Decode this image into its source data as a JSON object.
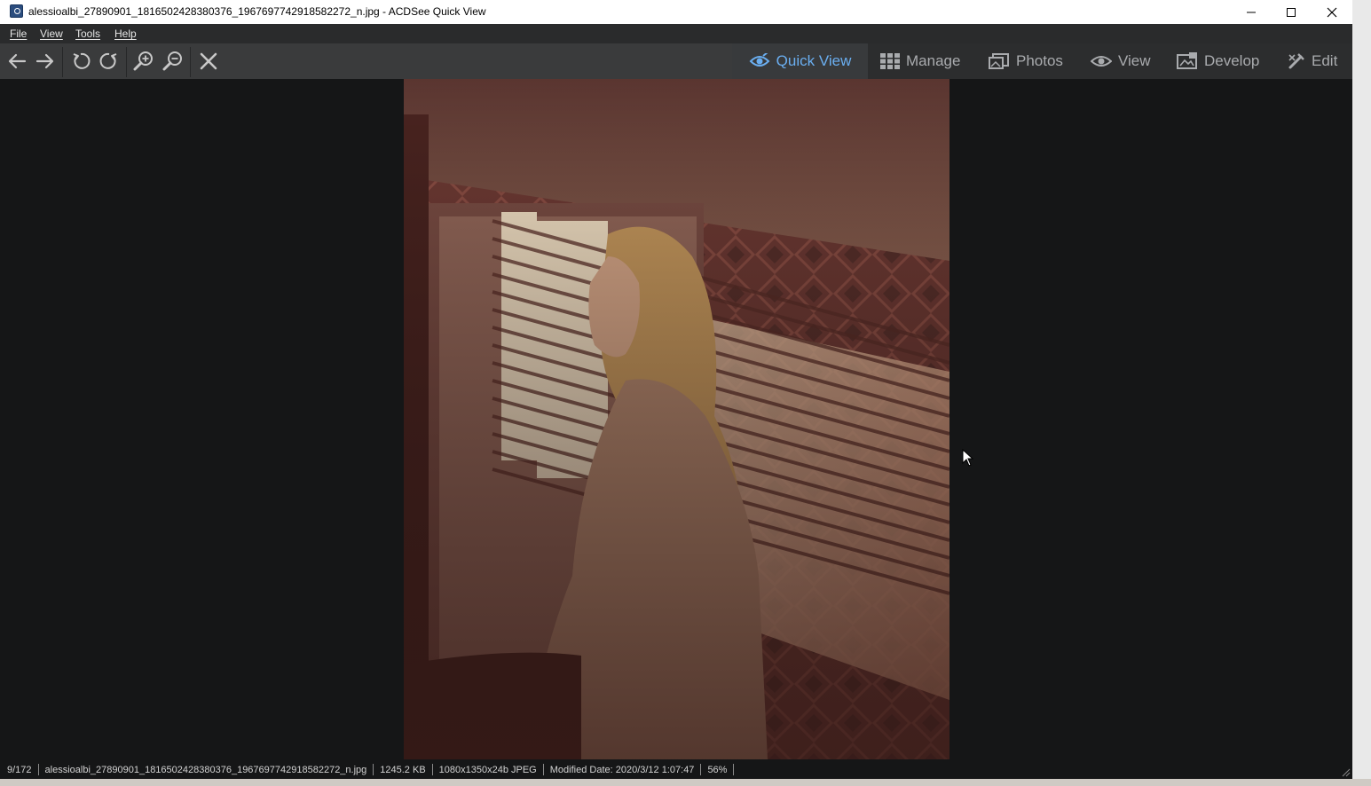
{
  "window": {
    "title": "alessioalbi_27890901_1816502428380376_1967697742918582272_n.jpg - ACDSee Quick View"
  },
  "menu": [
    "File",
    "View",
    "Tools",
    "Help"
  ],
  "toolbar": {
    "nav_icons": [
      "arrow-left-icon",
      "arrow-right-icon",
      "rotate-left-icon",
      "rotate-right-icon",
      "zoom-in-icon",
      "zoom-out-icon",
      "close-x-icon"
    ]
  },
  "modes": [
    {
      "label": "Quick View",
      "icon": "eye-icon",
      "active": true
    },
    {
      "label": "Manage",
      "icon": "grid-icon",
      "active": false
    },
    {
      "label": "Photos",
      "icon": "photos-icon",
      "active": false
    },
    {
      "label": "View",
      "icon": "eye-icon",
      "active": false
    },
    {
      "label": "Develop",
      "icon": "develop-icon",
      "active": false
    },
    {
      "label": "Edit",
      "icon": "brush-icon",
      "active": false
    }
  ],
  "status": {
    "position": "9/172",
    "filename": "alessioalbi_27890901_1816502428380376_1967697742918582272_n.jpg",
    "filesize": "1245.2 KB",
    "dimensions": "1080x1350x24b JPEG",
    "modified": "Modified Date: 2020/3/12 1:07:47",
    "zoom": "56%"
  },
  "colors": {
    "active_mode": "#6aaef0",
    "viewer_background": "#151617",
    "toolbar": "#3a3b3c"
  }
}
